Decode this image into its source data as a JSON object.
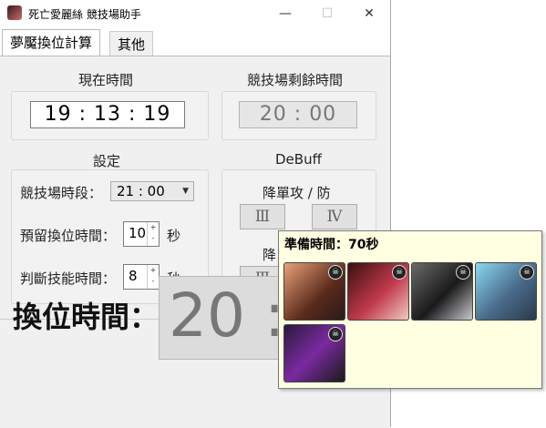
{
  "window": {
    "title": "死亡愛麗絲 競技場助手",
    "minimize_glyph": "—",
    "maximize_glyph": "☐",
    "close_glyph": "✕"
  },
  "tabs": [
    {
      "label": "夢魘換位計算"
    },
    {
      "label": "其他"
    }
  ],
  "current_time": {
    "label": "現在時間",
    "value": "19 : 13 : 19"
  },
  "arena_remaining": {
    "label": "競技場剩餘時間",
    "value": "20 : 00"
  },
  "settings": {
    "label": "設定",
    "arena_period_label": "競技場時段：",
    "arena_period_value": "21 : 00",
    "reserve_label": "預留換位時間：",
    "reserve_value": "10",
    "reserve_unit": "秒",
    "judge_label": "判斷技能時間：",
    "judge_value": "8",
    "judge_unit": "秒"
  },
  "debuff": {
    "label": "DeBuff",
    "group1_label": "降單攻 / 防",
    "btn_iii": "Ⅲ",
    "btn_iv": "Ⅳ",
    "group2_label": "降",
    "btn2_iii": "Ⅲ"
  },
  "swap": {
    "label": "換位時間：",
    "value": "20 : 00"
  },
  "tooltip": {
    "title": "準備時間：70秒"
  },
  "colors": {
    "tooltip_bg": "#ffffe1",
    "panel_bg": "#f0f0f0"
  }
}
